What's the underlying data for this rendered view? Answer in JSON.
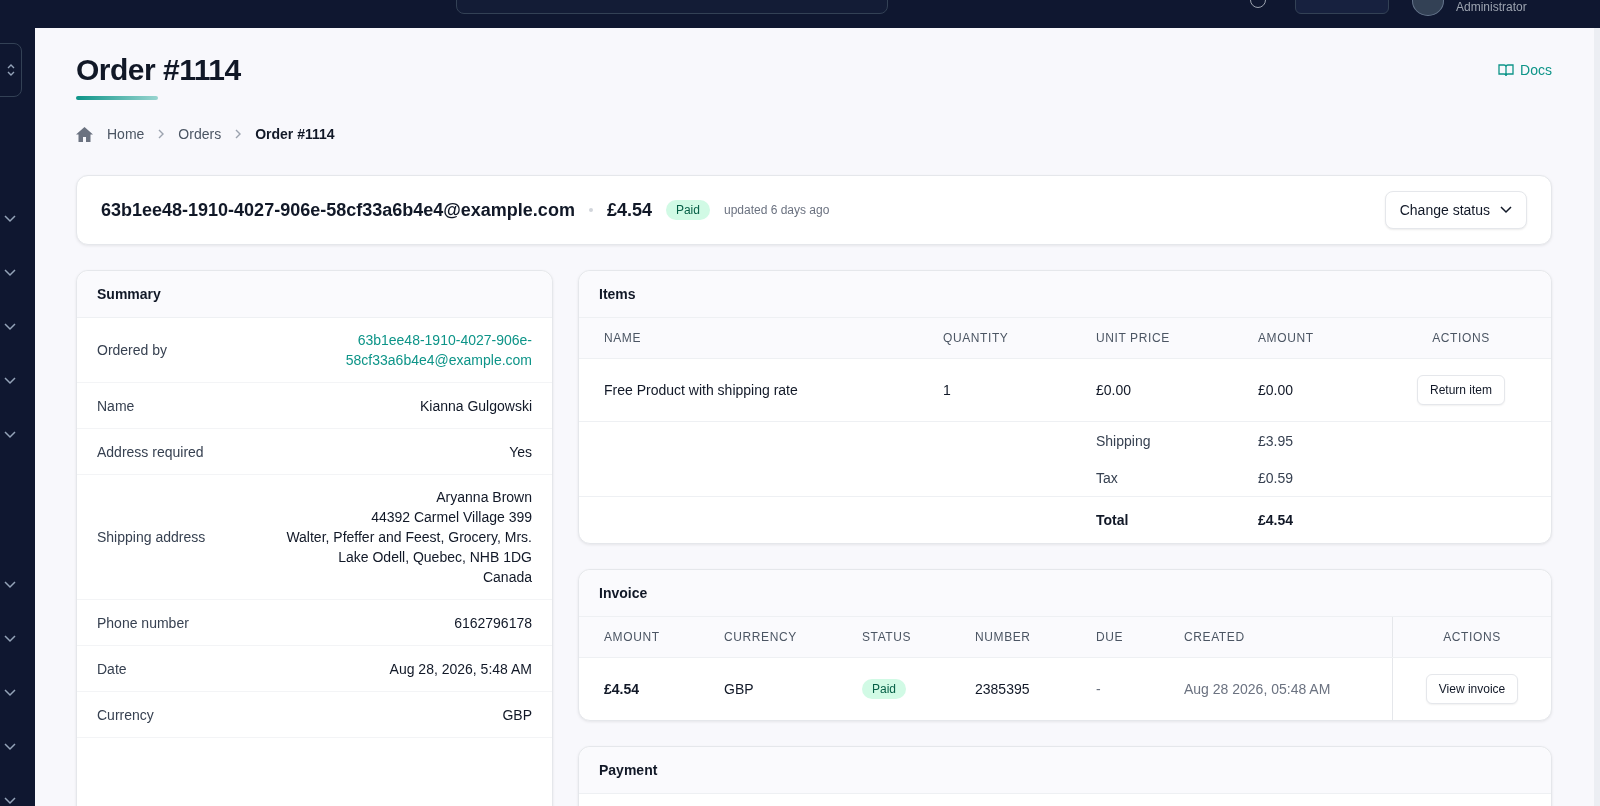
{
  "top_bar": {
    "user_role": "Administrator"
  },
  "page": {
    "title": "Order #1114",
    "docs_link": "Docs",
    "breadcrumbs": [
      {
        "label": "Home",
        "current": false
      },
      {
        "label": "Orders",
        "current": false
      },
      {
        "label": "Order #1114",
        "current": true
      }
    ]
  },
  "order_header": {
    "email": "63b1ee48-1910-4027-906e-58cf33a6b4e4@example.com",
    "amount": "£4.54",
    "status": "Paid",
    "updated": "updated 6 days ago",
    "change_status_button": "Change status"
  },
  "summary": {
    "title": "Summary",
    "rows": [
      {
        "label": "Ordered by",
        "kind": "link",
        "lines": [
          "63b1ee48-1910-4027-906e-",
          "58cf33a6b4e4@example.com"
        ]
      },
      {
        "label": "Name",
        "kind": "text",
        "lines": [
          "Kianna Gulgowski"
        ]
      },
      {
        "label": "Address required",
        "kind": "text",
        "lines": [
          "Yes"
        ]
      },
      {
        "label": "Shipping address",
        "kind": "text",
        "lines": [
          "Aryanna Brown",
          "44392 Carmel Village 399",
          "Walter, Pfeffer and Feest, Grocery, Mrs.",
          "Lake Odell, Quebec, NHB 1DG",
          "Canada"
        ]
      },
      {
        "label": "Phone number",
        "kind": "text",
        "lines": [
          "6162796178"
        ]
      },
      {
        "label": "Date",
        "kind": "text",
        "lines": [
          "Aug 28, 2026, 5:48 AM"
        ]
      },
      {
        "label": "Currency",
        "kind": "text",
        "lines": [
          "GBP"
        ]
      }
    ]
  },
  "items": {
    "title": "Items",
    "columns": [
      "NAME",
      "QUANTITY",
      "UNIT PRICE",
      "AMOUNT",
      "ACTIONS"
    ],
    "rows": [
      {
        "name": "Free Product with shipping rate",
        "quantity": "1",
        "unit_price": "£0.00",
        "amount": "£0.00",
        "action": "Return item"
      }
    ],
    "totals": [
      {
        "label": "Shipping",
        "value": "£3.95",
        "bold": false
      },
      {
        "label": "Tax",
        "value": "£0.59",
        "bold": false
      },
      {
        "label": "Total",
        "value": "£4.54",
        "bold": true
      }
    ]
  },
  "invoice": {
    "title": "Invoice",
    "columns": [
      "AMOUNT",
      "CURRENCY",
      "STATUS",
      "NUMBER",
      "DUE",
      "CREATED",
      "ACTIONS"
    ],
    "rows": [
      {
        "amount": "£4.54",
        "currency": "GBP",
        "status": "Paid",
        "number": "2385395",
        "due": "-",
        "created": "Aug 28 2026, 05:48 AM",
        "action": "View invoice"
      }
    ]
  },
  "payment": {
    "title": "Payment"
  }
}
